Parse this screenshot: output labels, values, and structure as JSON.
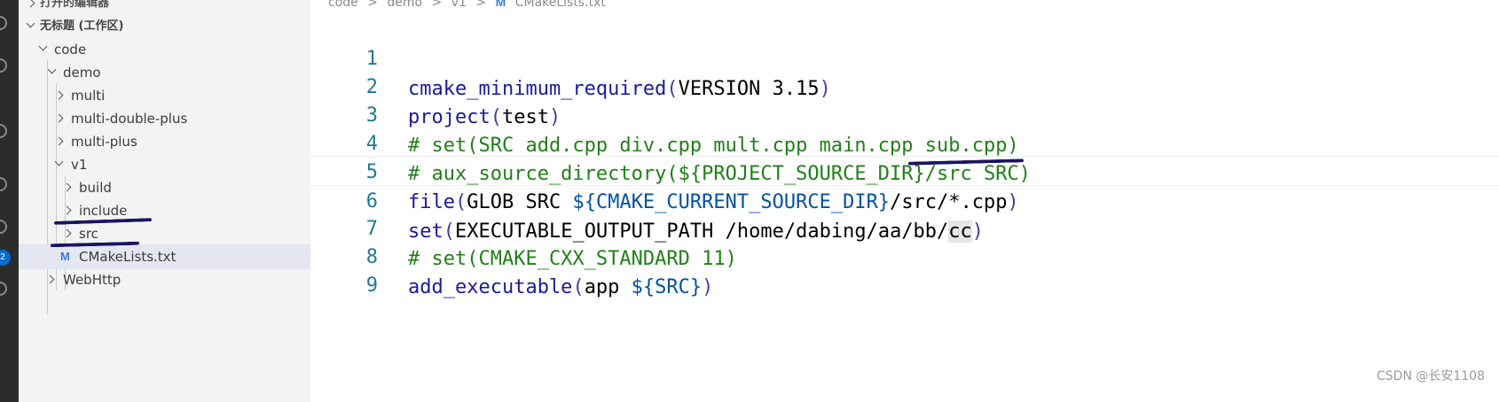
{
  "explorer": {
    "open_editors": "打开的编辑器",
    "workspace": "无标题 (工作区)",
    "tree": [
      {
        "label": "code",
        "expanded": true
      },
      {
        "label": "demo",
        "expanded": true
      },
      {
        "label": "multi",
        "expanded": false
      },
      {
        "label": "multi-double-plus",
        "expanded": false
      },
      {
        "label": "multi-plus",
        "expanded": false
      },
      {
        "label": "v1",
        "expanded": true
      },
      {
        "label": "build",
        "expanded": false
      },
      {
        "label": "include",
        "expanded": false
      },
      {
        "label": "src",
        "expanded": false
      },
      {
        "label": "CMakeLists.txt",
        "file_icon": "M"
      },
      {
        "label": "WebHttp",
        "expanded": false
      }
    ]
  },
  "activity_bar": {
    "badge": "2"
  },
  "breadcrumb": [
    "code",
    ">",
    "demo",
    ">",
    "v1",
    ">",
    "CMakeLists.txt"
  ],
  "editor": {
    "lines": [
      {
        "n": "1",
        "text": "cmake_minimum_required(VERSION 3.15)"
      },
      {
        "n": "2",
        "text": "project(test)"
      },
      {
        "n": "3",
        "text": "# set(SRC add.cpp div.cpp mult.cpp main.cpp sub.cpp)"
      },
      {
        "n": "4",
        "text": "# aux_source_directory(${PROJECT_SOURCE_DIR}/src SRC)"
      },
      {
        "n": "5",
        "text": "file(GLOB SRC ${CMAKE_CURRENT_SOURCE_DIR}/src/*.cpp)"
      },
      {
        "n": "6",
        "text": "set(EXECUTABLE_OUTPUT_PATH /home/dabing/aa/bb/cc)"
      },
      {
        "n": "7",
        "text": "# set(CMAKE_CXX_STANDARD 11)"
      },
      {
        "n": "8",
        "text": "add_executable(app ${SRC})"
      },
      {
        "n": "9",
        "text": ""
      }
    ],
    "segments": {
      "l1": [
        "cmake_minimum_required",
        "(",
        "VERSION 3.15",
        ")"
      ],
      "l2": [
        "project",
        "(",
        "test",
        ")"
      ],
      "l3": "# set(SRC add.cpp div.cpp mult.cpp main.cpp sub.cpp)",
      "l4": "# aux_source_directory(${PROJECT_SOURCE_DIR}/src SRC)",
      "l5": [
        "file",
        "(",
        "GLOB SRC ",
        "${",
        "CMAKE_CURRENT_SOURCE_DIR",
        "}",
        "/src/*.cpp",
        ")"
      ],
      "l6": [
        "set",
        "(",
        "EXECUTABLE_OUTPUT_PATH /home/dabing/aa/bb/",
        "cc",
        ")"
      ],
      "l7": "# set(CMAKE_CXX_STANDARD 11)",
      "l8": [
        "add_executable",
        "(",
        "app ",
        "${",
        "SRC",
        "}",
        ")"
      ]
    }
  },
  "watermark": "CSDN @长安1108"
}
